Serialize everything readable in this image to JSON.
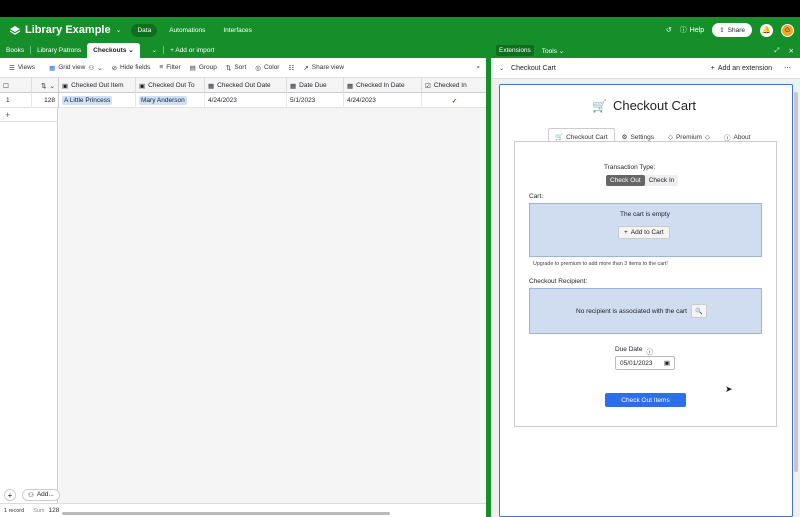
{
  "header": {
    "base_name": "Library Example",
    "nav": [
      "Data",
      "Automations",
      "Interfaces"
    ],
    "help": "Help",
    "share": "Share",
    "avatar": "G"
  },
  "tabs": {
    "items": [
      "Books",
      "Library Patrons",
      "Checkouts"
    ],
    "add_import": "Add or import"
  },
  "toolbar": {
    "views": "Views",
    "grid_view": "Grid view",
    "hide_fields": "Hide fields",
    "filter": "Filter",
    "group": "Group",
    "sort": "Sort",
    "color": "Color",
    "share_view": "Share view"
  },
  "grid": {
    "columns": [
      "Checked Out Item",
      "Checked Out To",
      "Checked Out Date",
      "Date Due",
      "Checked In Date",
      "Checked In"
    ],
    "row": {
      "num": "1",
      "id": "128",
      "item": "A Little Princess",
      "to": "Mary Anderson",
      "out_date": "4/24/2023",
      "due": "5/1/2023",
      "in_date": "4/24/2023",
      "checked_in": "✓"
    },
    "footer_records": "1 record",
    "footer_sum_label": "Sum",
    "footer_sum": "128",
    "add": "Add..."
  },
  "extensions": {
    "title": "Extensions",
    "tools": "Tools",
    "panel_title": "Checkout Cart",
    "add_extension": "Add an extension"
  },
  "cart": {
    "title": "Checkout Cart",
    "tabs": [
      "Checkout Cart",
      "Settings",
      "Premium",
      "About"
    ],
    "transaction_type_label": "Transaction Type:",
    "toggle": [
      "Check Out",
      "Check In"
    ],
    "cart_label": "Cart:",
    "empty_text": "The cart is empty",
    "add_button": "Add to Cart",
    "upgrade_text": "Upgrade to premium to add more than 3 items to the cart!",
    "recipient_label": "Checkout Recipient:",
    "no_recipient": "No recipient is associated with the cart",
    "due_label": "Due Date",
    "due_value": "05/01/2023",
    "checkout_button": "Check Out Items"
  },
  "colors": {
    "brand_green": "#168f2a",
    "accent_blue": "#2c6fe8",
    "cart_box": "#d0dcf0"
  }
}
